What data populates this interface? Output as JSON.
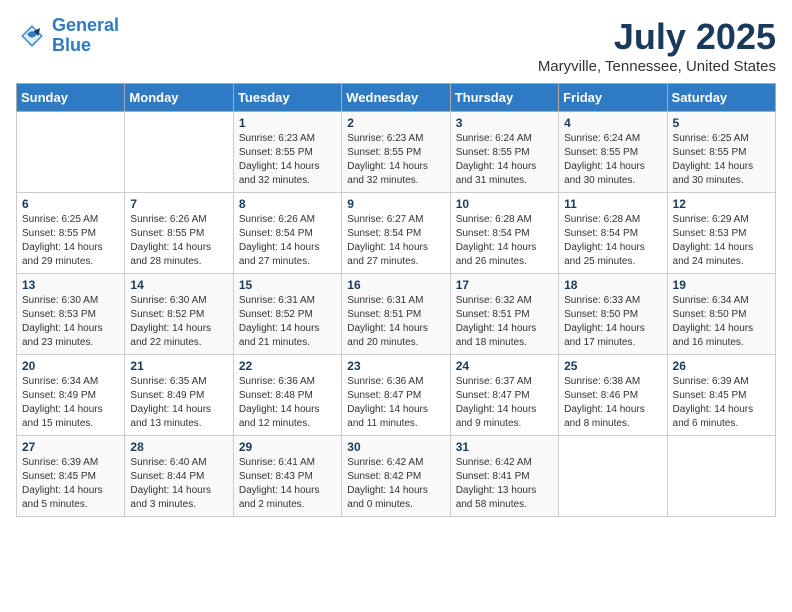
{
  "header": {
    "logo_line1": "General",
    "logo_line2": "Blue",
    "title": "July 2025",
    "subtitle": "Maryville, Tennessee, United States"
  },
  "days_of_week": [
    "Sunday",
    "Monday",
    "Tuesday",
    "Wednesday",
    "Thursday",
    "Friday",
    "Saturday"
  ],
  "weeks": [
    [
      {
        "num": "",
        "info": ""
      },
      {
        "num": "",
        "info": ""
      },
      {
        "num": "1",
        "info": "Sunrise: 6:23 AM\nSunset: 8:55 PM\nDaylight: 14 hours and 32 minutes."
      },
      {
        "num": "2",
        "info": "Sunrise: 6:23 AM\nSunset: 8:55 PM\nDaylight: 14 hours and 32 minutes."
      },
      {
        "num": "3",
        "info": "Sunrise: 6:24 AM\nSunset: 8:55 PM\nDaylight: 14 hours and 31 minutes."
      },
      {
        "num": "4",
        "info": "Sunrise: 6:24 AM\nSunset: 8:55 PM\nDaylight: 14 hours and 30 minutes."
      },
      {
        "num": "5",
        "info": "Sunrise: 6:25 AM\nSunset: 8:55 PM\nDaylight: 14 hours and 30 minutes."
      }
    ],
    [
      {
        "num": "6",
        "info": "Sunrise: 6:25 AM\nSunset: 8:55 PM\nDaylight: 14 hours and 29 minutes."
      },
      {
        "num": "7",
        "info": "Sunrise: 6:26 AM\nSunset: 8:55 PM\nDaylight: 14 hours and 28 minutes."
      },
      {
        "num": "8",
        "info": "Sunrise: 6:26 AM\nSunset: 8:54 PM\nDaylight: 14 hours and 27 minutes."
      },
      {
        "num": "9",
        "info": "Sunrise: 6:27 AM\nSunset: 8:54 PM\nDaylight: 14 hours and 27 minutes."
      },
      {
        "num": "10",
        "info": "Sunrise: 6:28 AM\nSunset: 8:54 PM\nDaylight: 14 hours and 26 minutes."
      },
      {
        "num": "11",
        "info": "Sunrise: 6:28 AM\nSunset: 8:54 PM\nDaylight: 14 hours and 25 minutes."
      },
      {
        "num": "12",
        "info": "Sunrise: 6:29 AM\nSunset: 8:53 PM\nDaylight: 14 hours and 24 minutes."
      }
    ],
    [
      {
        "num": "13",
        "info": "Sunrise: 6:30 AM\nSunset: 8:53 PM\nDaylight: 14 hours and 23 minutes."
      },
      {
        "num": "14",
        "info": "Sunrise: 6:30 AM\nSunset: 8:52 PM\nDaylight: 14 hours and 22 minutes."
      },
      {
        "num": "15",
        "info": "Sunrise: 6:31 AM\nSunset: 8:52 PM\nDaylight: 14 hours and 21 minutes."
      },
      {
        "num": "16",
        "info": "Sunrise: 6:31 AM\nSunset: 8:51 PM\nDaylight: 14 hours and 20 minutes."
      },
      {
        "num": "17",
        "info": "Sunrise: 6:32 AM\nSunset: 8:51 PM\nDaylight: 14 hours and 18 minutes."
      },
      {
        "num": "18",
        "info": "Sunrise: 6:33 AM\nSunset: 8:50 PM\nDaylight: 14 hours and 17 minutes."
      },
      {
        "num": "19",
        "info": "Sunrise: 6:34 AM\nSunset: 8:50 PM\nDaylight: 14 hours and 16 minutes."
      }
    ],
    [
      {
        "num": "20",
        "info": "Sunrise: 6:34 AM\nSunset: 8:49 PM\nDaylight: 14 hours and 15 minutes."
      },
      {
        "num": "21",
        "info": "Sunrise: 6:35 AM\nSunset: 8:49 PM\nDaylight: 14 hours and 13 minutes."
      },
      {
        "num": "22",
        "info": "Sunrise: 6:36 AM\nSunset: 8:48 PM\nDaylight: 14 hours and 12 minutes."
      },
      {
        "num": "23",
        "info": "Sunrise: 6:36 AM\nSunset: 8:47 PM\nDaylight: 14 hours and 11 minutes."
      },
      {
        "num": "24",
        "info": "Sunrise: 6:37 AM\nSunset: 8:47 PM\nDaylight: 14 hours and 9 minutes."
      },
      {
        "num": "25",
        "info": "Sunrise: 6:38 AM\nSunset: 8:46 PM\nDaylight: 14 hours and 8 minutes."
      },
      {
        "num": "26",
        "info": "Sunrise: 6:39 AM\nSunset: 8:45 PM\nDaylight: 14 hours and 6 minutes."
      }
    ],
    [
      {
        "num": "27",
        "info": "Sunrise: 6:39 AM\nSunset: 8:45 PM\nDaylight: 14 hours and 5 minutes."
      },
      {
        "num": "28",
        "info": "Sunrise: 6:40 AM\nSunset: 8:44 PM\nDaylight: 14 hours and 3 minutes."
      },
      {
        "num": "29",
        "info": "Sunrise: 6:41 AM\nSunset: 8:43 PM\nDaylight: 14 hours and 2 minutes."
      },
      {
        "num": "30",
        "info": "Sunrise: 6:42 AM\nSunset: 8:42 PM\nDaylight: 14 hours and 0 minutes."
      },
      {
        "num": "31",
        "info": "Sunrise: 6:42 AM\nSunset: 8:41 PM\nDaylight: 13 hours and 58 minutes."
      },
      {
        "num": "",
        "info": ""
      },
      {
        "num": "",
        "info": ""
      }
    ]
  ]
}
